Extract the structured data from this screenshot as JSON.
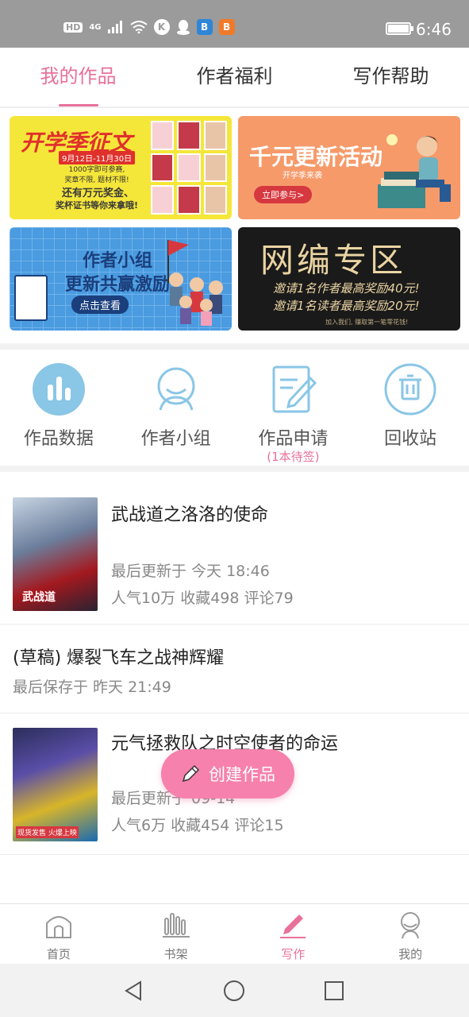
{
  "status_bar": {
    "indicators": [
      "HD",
      "4G",
      "K",
      "B",
      "B"
    ],
    "signal_icon": "signal-icon",
    "wifi_icon": "wifi-icon",
    "battery_icon": "battery-icon",
    "time": "6:46"
  },
  "tabs": [
    {
      "label": "我的作品",
      "active": true
    },
    {
      "label": "作者福利",
      "active": false
    },
    {
      "label": "写作帮助",
      "active": false
    }
  ],
  "banners": {
    "b1": {
      "title": "开学季征文",
      "date": "9月12日-11月30日",
      "line1": "1000字即可参赛,",
      "line2": "奖章不限, 题材不限!",
      "prize": "还有万元奖金、",
      "prize2": "奖杯证书等你来拿哦!"
    },
    "b2": {
      "title": "千元更新活动",
      "subtitle": "开学季来袭",
      "button": "立即参与>"
    },
    "b3": {
      "line1": "作者小组",
      "line2": "更新共赢激励",
      "button": "点击查看"
    },
    "b4": {
      "title": "网编专区",
      "line1": "邀请1名作者最高奖励40元!",
      "line2": "邀请1名读者最高奖励20元!",
      "footer": "加入我们, 赚取第一笔零花钱!"
    }
  },
  "quick_actions": [
    {
      "label": "作品数据",
      "icon": "bar-chart-icon"
    },
    {
      "label": "作者小组",
      "icon": "group-icon"
    },
    {
      "label": "作品申请",
      "icon": "edit-document-icon",
      "sub": "(1本待签)"
    },
    {
      "label": "回收站",
      "icon": "trash-icon"
    }
  ],
  "works": [
    {
      "title": "武战道之洛洛的使命",
      "updated": "最后更新于 今天 18:46",
      "stats": "人气10万 收藏498 评论79",
      "cover_text": "武战道"
    },
    {
      "title": "(草稿) 爆裂飞车之战神辉耀",
      "updated": "最后保存于 昨天 21:49"
    },
    {
      "title": "元气拯救队之时空使者的命运",
      "updated": "最后更新于 09-14",
      "stats": "人气6万 收藏454 评论15",
      "cover_text": "现货发售 火爆上映"
    }
  ],
  "fab": {
    "label": "创建作品",
    "icon": "pencil-icon"
  },
  "bottom_nav": [
    {
      "label": "首页",
      "icon": "home-icon",
      "active": false
    },
    {
      "label": "书架",
      "icon": "bookshelf-icon",
      "active": false
    },
    {
      "label": "写作",
      "icon": "pen-icon",
      "active": true
    },
    {
      "label": "我的",
      "icon": "profile-icon",
      "active": false
    }
  ],
  "colors": {
    "accent": "#e8719a",
    "icon_blue": "#8ac6e6",
    "fab": "#f681ac",
    "status_bar": "#9b9b9b"
  }
}
